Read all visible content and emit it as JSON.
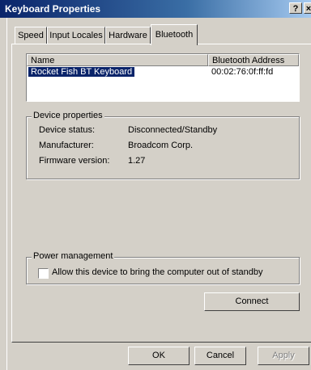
{
  "window": {
    "title": "Keyboard Properties",
    "help_label": "?",
    "close_label": "×"
  },
  "tabs": [
    {
      "label": "Speed"
    },
    {
      "label": "Input Locales"
    },
    {
      "label": "Hardware"
    },
    {
      "label": "Bluetooth",
      "active": true
    }
  ],
  "device_list": {
    "columns": [
      "Name",
      "Bluetooth Address"
    ],
    "rows": [
      {
        "name": "Rocket Fish BT Keyboard",
        "address": "00:02:76:0f:ff:fd",
        "selected": true
      }
    ]
  },
  "device_properties": {
    "legend": "Device properties",
    "items": [
      {
        "label": "Device status:",
        "value": "Disconnected/Standby"
      },
      {
        "label": "Manufacturer:",
        "value": "Broadcom Corp."
      },
      {
        "label": "Firmware version:",
        "value": "1.27"
      }
    ]
  },
  "power_management": {
    "legend": "Power management",
    "checkbox_label": "Allow this device to bring the computer out of standby",
    "checked": false
  },
  "buttons": {
    "connect": "Connect",
    "ok": "OK",
    "cancel": "Cancel",
    "apply": "Apply"
  }
}
